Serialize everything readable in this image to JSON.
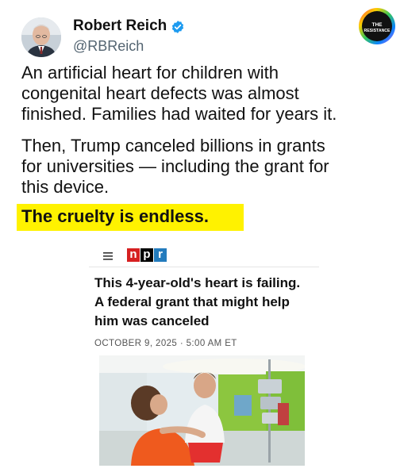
{
  "author": {
    "name": "Robert Reich",
    "handle": "@RBReich"
  },
  "badge_text": [
    "THE",
    "RESISTANCE"
  ],
  "tweet": {
    "paragraph1": [
      "An artificial heart for children with",
      "congenital heart defects was almost",
      "finished. Families had waited for years it."
    ],
    "paragraph2": [
      "Then, Trump canceled billions in grants",
      "for universities — including the grant for",
      "this device."
    ],
    "emphasis": "The cruelty is endless."
  },
  "article": {
    "source": "npr",
    "headline": [
      "This 4-year-old's heart is failing.",
      "A federal grant that might help",
      "him was canceled"
    ],
    "date": "OCTOBER 9, 2025 · 5:00 AM ET"
  },
  "colors": {
    "highlight": "#fff200",
    "verified": "#1d9bf0",
    "npr_red": "#d62021",
    "npr_blue": "#237bbd"
  }
}
